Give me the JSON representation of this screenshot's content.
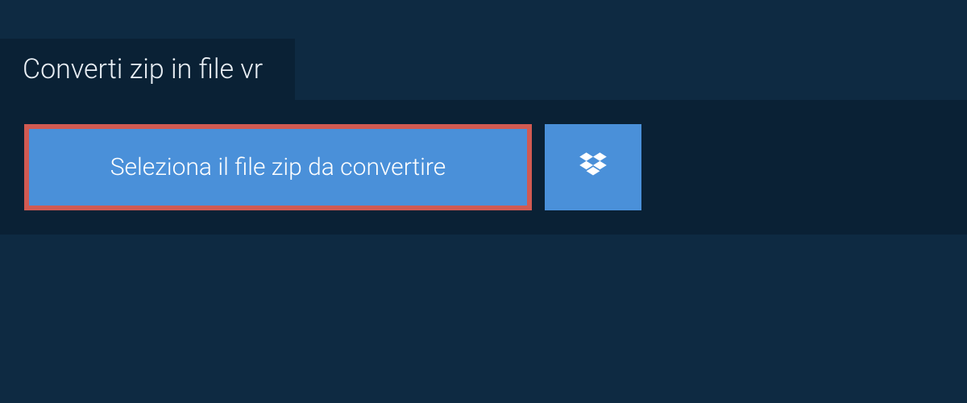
{
  "tab": {
    "title": "Converti zip in file vr"
  },
  "actions": {
    "select_file_label": "Seleziona il file zip da convertire"
  },
  "colors": {
    "background": "#0e2a42",
    "panel": "#0a2135",
    "button": "#4a90d9",
    "highlight_border": "#d15a52",
    "text": "#ffffff"
  }
}
